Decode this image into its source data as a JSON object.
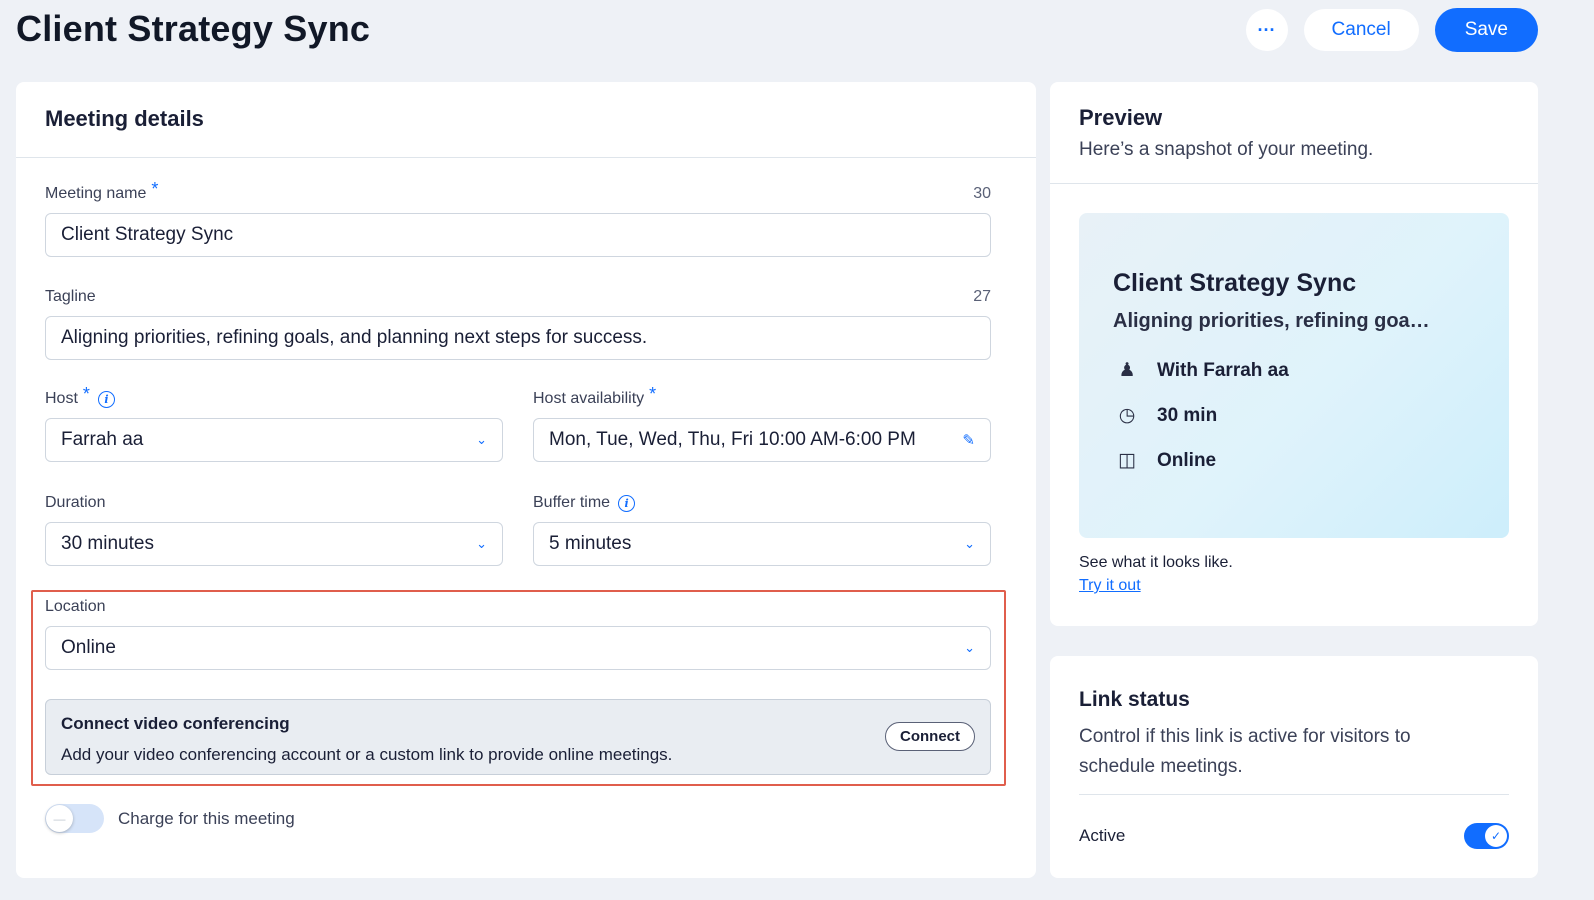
{
  "page": {
    "title": "Client Strategy Sync",
    "more_label": "···",
    "cancel_label": "Cancel",
    "save_label": "Save"
  },
  "meeting_details": {
    "heading": "Meeting details",
    "meeting_name": {
      "label": "Meeting name",
      "required": "*",
      "counter": "30",
      "value": "Client Strategy Sync"
    },
    "tagline": {
      "label": "Tagline",
      "counter": "27",
      "value": "Aligning priorities, refining goals, and planning next steps for success."
    },
    "host": {
      "label": "Host",
      "required": "*",
      "value": "Farrah aa"
    },
    "host_availability": {
      "label": "Host availability",
      "required": "*",
      "value": "Mon, Tue, Wed, Thu, Fri 10:00 AM-6:00 PM"
    },
    "duration": {
      "label": "Duration",
      "value": "30 minutes"
    },
    "buffer_time": {
      "label": "Buffer time",
      "value": "5 minutes"
    },
    "location": {
      "label": "Location",
      "value": "Online"
    },
    "video_conferencing": {
      "title": "Connect video conferencing",
      "description": "Add your video conferencing account or a custom link to provide online meetings.",
      "connect_label": "Connect"
    },
    "charge": {
      "label": "Charge for this meeting",
      "enabled": false
    }
  },
  "preview": {
    "heading": "Preview",
    "subtitle": "Here’s a snapshot of your meeting.",
    "card": {
      "title": "Client Strategy Sync",
      "tagline": "Aligning priorities, refining goa…",
      "host": "With Farrah aa",
      "duration": "30 min",
      "location": "Online"
    },
    "see_text": "See what it looks like.",
    "try_link": "Try it out"
  },
  "link_status": {
    "heading": "Link status",
    "description": "Control if this link is active for visitors to schedule meetings.",
    "active_label": "Active",
    "active": true
  },
  "colors": {
    "accent": "#116dff",
    "background": "#eef1f6",
    "highlight": "#e05e4c"
  }
}
